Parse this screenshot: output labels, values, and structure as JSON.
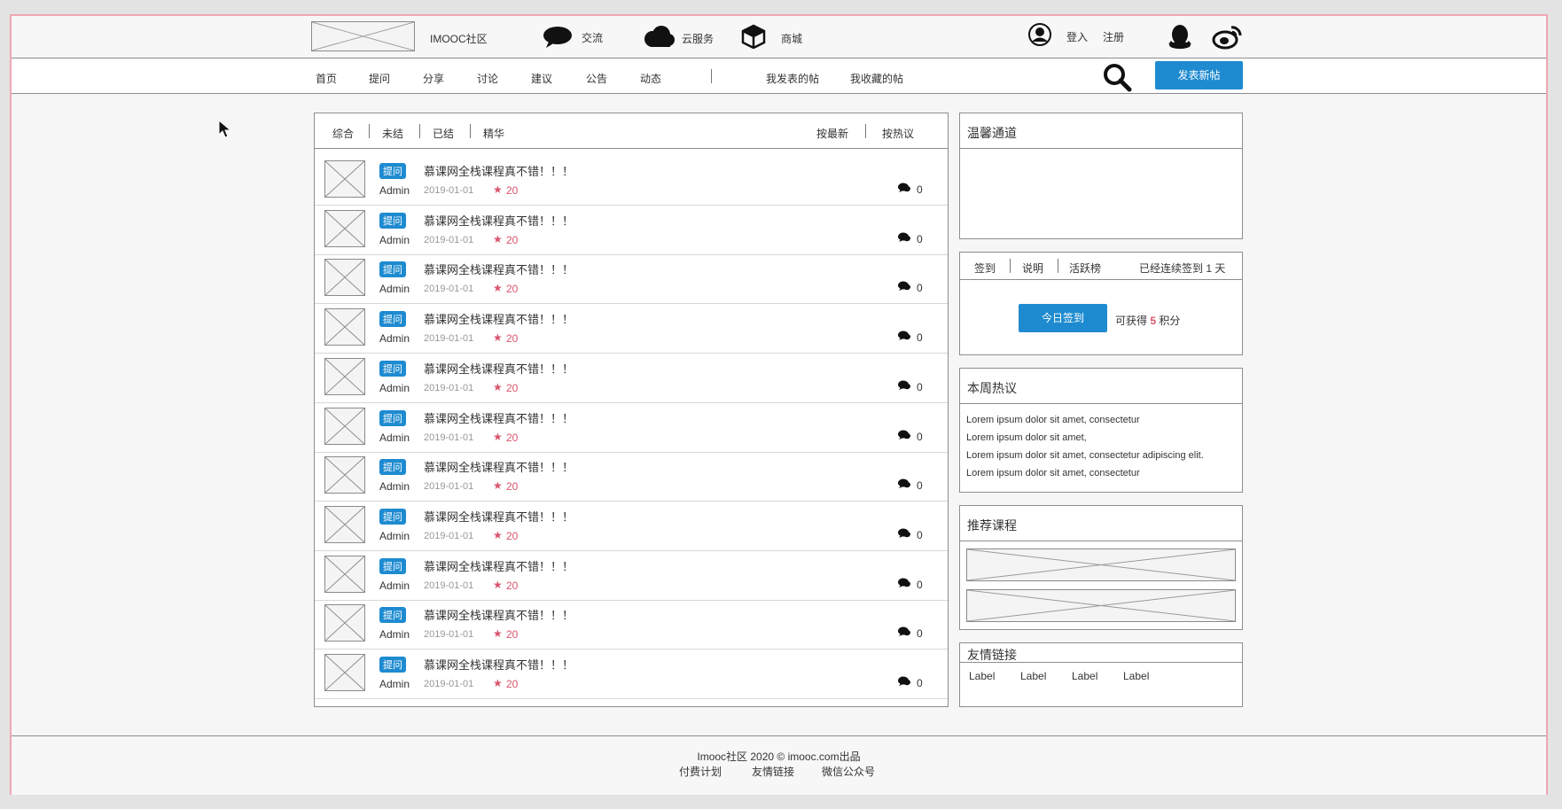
{
  "header": {
    "site_name": "IMOOC社区",
    "nav": [
      {
        "label": "交流",
        "icon": "chat-bubble-icon"
      },
      {
        "label": "云服务",
        "icon": "cloud-icon"
      },
      {
        "label": "商城",
        "icon": "box-icon"
      }
    ],
    "login": "登入",
    "register": "注册"
  },
  "subnav": {
    "items": [
      "首页",
      "提问",
      "分享",
      "讨论",
      "建议",
      "公告",
      "动态"
    ],
    "my_posts": "我发表的帖",
    "my_favs": "我收藏的帖",
    "new_post": "发表新帖"
  },
  "filters": {
    "left": [
      "综合",
      "未结",
      "已结",
      "精华"
    ],
    "right": [
      "按最新",
      "按热议"
    ]
  },
  "posts": [
    {
      "tag": "提问",
      "title": "慕课网全栈课程真不错！！！",
      "author": "Admin",
      "date": "2019-01-01",
      "score": "20",
      "comments": "0"
    },
    {
      "tag": "提问",
      "title": "慕课网全栈课程真不错！！！",
      "author": "Admin",
      "date": "2019-01-01",
      "score": "20",
      "comments": "0"
    },
    {
      "tag": "提问",
      "title": "慕课网全栈课程真不错！！！",
      "author": "Admin",
      "date": "2019-01-01",
      "score": "20",
      "comments": "0"
    },
    {
      "tag": "提问",
      "title": "慕课网全栈课程真不错！！！",
      "author": "Admin",
      "date": "2019-01-01",
      "score": "20",
      "comments": "0"
    },
    {
      "tag": "提问",
      "title": "慕课网全栈课程真不错！！！",
      "author": "Admin",
      "date": "2019-01-01",
      "score": "20",
      "comments": "0"
    },
    {
      "tag": "提问",
      "title": "慕课网全栈课程真不错！！！",
      "author": "Admin",
      "date": "2019-01-01",
      "score": "20",
      "comments": "0"
    },
    {
      "tag": "提问",
      "title": "慕课网全栈课程真不错！！！",
      "author": "Admin",
      "date": "2019-01-01",
      "score": "20",
      "comments": "0"
    },
    {
      "tag": "提问",
      "title": "慕课网全栈课程真不错！！！",
      "author": "Admin",
      "date": "2019-01-01",
      "score": "20",
      "comments": "0"
    },
    {
      "tag": "提问",
      "title": "慕课网全栈课程真不错！！！",
      "author": "Admin",
      "date": "2019-01-01",
      "score": "20",
      "comments": "0"
    },
    {
      "tag": "提问",
      "title": "慕课网全栈课程真不错！！！",
      "author": "Admin",
      "date": "2019-01-01",
      "score": "20",
      "comments": "0"
    },
    {
      "tag": "提问",
      "title": "慕课网全栈课程真不错！！！",
      "author": "Admin",
      "date": "2019-01-01",
      "score": "20",
      "comments": "0"
    }
  ],
  "sidebar": {
    "warm_title": "温馨通道",
    "signin_tabs": [
      "签到",
      "说明",
      "活跃榜"
    ],
    "streak_prefix": "已经连续签到",
    "streak_days": "1",
    "streak_suffix": "天",
    "signin_button": "今日签到",
    "reward_prefix": "可获得",
    "reward_points": "5",
    "reward_suffix": "积分",
    "hot_title": "本周热议",
    "hot_items": [
      "Lorem ipsum dolor sit amet, consectetur",
      "Lorem ipsum dolor sit amet,",
      "Lorem ipsum dolor sit amet, consectetur adipiscing elit.",
      "Lorem ipsum dolor sit amet, consectetur"
    ],
    "courses_title": "推荐课程",
    "links_title": "友情链接",
    "links": [
      "Label",
      "Label",
      "Label",
      "Label"
    ]
  },
  "footer": {
    "line1": "Imooc社区 2020 © imooc.com出品",
    "links": [
      "付费计划",
      "友情链接",
      "微信公众号"
    ]
  },
  "colors": {
    "accent": "#1e8bd0",
    "star": "#d9546c",
    "frame": "#f0a6b4"
  }
}
